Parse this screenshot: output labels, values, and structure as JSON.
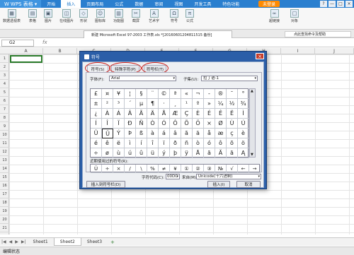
{
  "titlebar": {
    "app_name": "WPS 表格",
    "menus": [
      "开始",
      "插入",
      "页面布局",
      "公式",
      "数据",
      "审阅",
      "视图",
      "开发工具",
      "特色功能"
    ],
    "active_menu": "插入",
    "login_label": "未登录",
    "win_controls": [
      "?",
      "—",
      "□",
      "×"
    ]
  },
  "ribbon": {
    "items": [
      "数据透视表",
      "表格",
      "图片",
      "在线图片",
      "形状",
      "图标库",
      "功能图",
      "截屏",
      "艺术字",
      "符号",
      "公式",
      "超链接",
      "对象"
    ]
  },
  "tabbar": {
    "doc_title": "新建 Microsoft Excel 97-2003 工作表.xls *[20160601204811515 备份]",
    "help_text": "点此查找命令及帮助"
  },
  "formulabar": {
    "namebox": "G2",
    "fx": "fx"
  },
  "columns": [
    "A",
    "B",
    "C",
    "D",
    "E",
    "F",
    "G",
    "H",
    "I",
    "J"
  ],
  "rows": [
    "1",
    "2",
    "3",
    "4",
    "5",
    "6",
    "7",
    "8",
    "9",
    "10",
    "11",
    "12",
    "13",
    "14",
    "15",
    "16",
    "17",
    "18",
    "19",
    "20",
    "21"
  ],
  "dialog": {
    "title": "符号",
    "tabs": [
      "符号(S)",
      "特殊字符(P)",
      "符号栏(T)"
    ],
    "font_label": "字体(F):",
    "font_value": "Arial",
    "subset_label": "子集(U):",
    "subset_value": "拉丁语-1",
    "symbols": [
      [
        "£",
        "¤",
        "¥",
        "¦",
        "§",
        "¨",
        "©",
        "ª",
        "«",
        "¬",
        "-",
        "®",
        "¯",
        "°"
      ],
      [
        "±",
        "²",
        "³",
        "´",
        "µ",
        "¶",
        "·",
        "¸",
        "¹",
        "º",
        "»",
        "¼",
        "½",
        "¾"
      ],
      [
        "¿",
        "À",
        "Á",
        "Â",
        "Ã",
        "Ä",
        "Å",
        "Æ",
        "Ç",
        "È",
        "É",
        "Ê",
        "Ë",
        "Ì"
      ],
      [
        "Í",
        "Î",
        "Ï",
        "Ð",
        "Ñ",
        "Ò",
        "Ó",
        "Ô",
        "Õ",
        "Ö",
        "×",
        "Ø",
        "Ù",
        "Ú"
      ],
      [
        "Û",
        "Ü",
        "Ý",
        "Þ",
        "ß",
        "à",
        "á",
        "â",
        "ã",
        "ä",
        "å",
        "æ",
        "ç",
        "è"
      ],
      [
        "é",
        "ê",
        "ë",
        "ì",
        "í",
        "î",
        "ï",
        "ð",
        "ñ",
        "ò",
        "ó",
        "ô",
        "õ",
        "ö"
      ],
      [
        "÷",
        "ø",
        "ù",
        "ú",
        "û",
        "ü",
        "ý",
        "þ",
        "ÿ",
        "Ā",
        "ā",
        "Ă",
        "ă",
        "Ą"
      ]
    ],
    "recent_label": "近期使用过的符号(R):",
    "recent": [
      "Ü",
      "÷",
      "×",
      "/",
      "\\",
      "%",
      "≠",
      "¥",
      "①",
      "②",
      "③",
      "№",
      "√",
      "←",
      "→"
    ],
    "charcode_label": "字符代码(C):",
    "charcode_value": "00DC",
    "from_label": "来自(M):",
    "from_value": "Unicode(十六进制)",
    "insert_to_bar": "插入到符号栏(D)",
    "insert": "插入(I)",
    "cancel": "取消"
  },
  "sheets": [
    "Sheet1",
    "Sheet2",
    "Sheet3"
  ],
  "active_sheet": "Sheet2",
  "status": "编辑状态",
  "colors": {
    "accent": "#2a7fcf",
    "dialog": "#2b5ea8",
    "annotation": "#d0221c"
  }
}
